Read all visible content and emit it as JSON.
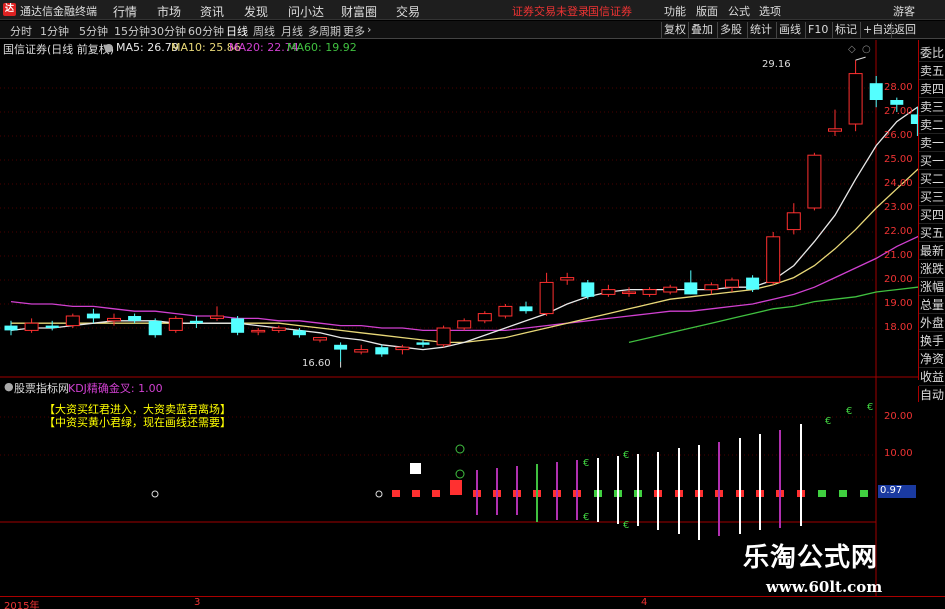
{
  "menubar": {
    "app_title": "通达信金融终端",
    "menus": [
      "行情",
      "市场",
      "资讯",
      "发现",
      "问小达",
      "财富圈",
      "交易"
    ],
    "alerts": [
      "证券交易未登录",
      "国信证券"
    ],
    "right_menus": [
      "功能",
      "版面",
      "公式",
      "选项"
    ],
    "user": "游客"
  },
  "toolbar": {
    "periods": [
      "分时",
      "1分钟",
      "5分钟",
      "15分钟",
      "30分钟",
      "60分钟",
      "日线",
      "周线",
      "月线",
      "多周期",
      "更多"
    ],
    "active_period": "日线",
    "right_buttons": [
      "复权",
      "叠加",
      "多股",
      "统计",
      "画线",
      "F10",
      "标记",
      "+自选",
      "返回"
    ]
  },
  "stock": {
    "name": "国信证券(日线 前复权)",
    "ma": [
      {
        "label": "MA5: 26.79",
        "color": "#e8e8e8"
      },
      {
        "label": "MA10: 25.86",
        "color": "#e8d878"
      },
      {
        "label": "MA20: 22.74",
        "color": "#d040d0"
      },
      {
        "label": "MA60: 19.92",
        "color": "#40c040"
      }
    ],
    "high_label": "29.16",
    "low_label": "16.60"
  },
  "side_tabs": [
    "委比",
    "卖五",
    "卖四",
    "卖三",
    "卖二",
    "卖一",
    "买一",
    "买二",
    "买三",
    "买四",
    "买五",
    "最新",
    "涨跌",
    "涨幅",
    "总量",
    "外盘",
    "换手",
    "净资",
    "收益"
  ],
  "side_auto": "自动",
  "price_axis": [
    "28.00",
    "27.00",
    "26.00",
    "25.00",
    "24.00",
    "23.00",
    "22.00",
    "21.00",
    "20.00",
    "19.00",
    "18.00"
  ],
  "indicator": {
    "title": "股票指标网",
    "subtitle": "KDJ精确金叉: 1.00",
    "strategy_lines": [
      "【大资买红君进入，大资卖蓝君离场】",
      "【中资买黄小君绿，现在画线还需要】"
    ],
    "axis": [
      "20.00",
      "10.00"
    ],
    "current_value": "0.97"
  },
  "date_axis": [
    "2015年",
    "3",
    "4"
  ],
  "watermark": {
    "cn": "乐淘公式网",
    "url": "www.60lt.com"
  },
  "colors": {
    "up": "#ff3030",
    "down": "#54ffff",
    "axis": "#a00000",
    "grid": "#4a0000"
  },
  "chart_data": {
    "type": "candlestick",
    "candles": [
      {
        "o": 18.1,
        "c": 17.9,
        "h": 18.3,
        "l": 17.7
      },
      {
        "o": 17.9,
        "c": 18.2,
        "h": 18.4,
        "l": 17.8
      },
      {
        "o": 18.1,
        "c": 18.0,
        "h": 18.3,
        "l": 17.9
      },
      {
        "o": 18.1,
        "c": 18.5,
        "h": 18.6,
        "l": 18.0
      },
      {
        "o": 18.6,
        "c": 18.4,
        "h": 18.8,
        "l": 18.2
      },
      {
        "o": 18.3,
        "c": 18.4,
        "h": 18.6,
        "l": 18.1
      },
      {
        "o": 18.5,
        "c": 18.3,
        "h": 18.6,
        "l": 18.2
      },
      {
        "o": 18.3,
        "c": 17.7,
        "h": 18.4,
        "l": 17.6
      },
      {
        "o": 17.9,
        "c": 18.4,
        "h": 18.5,
        "l": 17.8
      },
      {
        "o": 18.3,
        "c": 18.2,
        "h": 18.5,
        "l": 18.0
      },
      {
        "o": 18.4,
        "c": 18.5,
        "h": 18.9,
        "l": 18.3
      },
      {
        "o": 18.4,
        "c": 17.8,
        "h": 18.5,
        "l": 17.7
      },
      {
        "o": 17.9,
        "c": 17.9,
        "h": 18.0,
        "l": 17.7
      },
      {
        "o": 17.9,
        "c": 18.0,
        "h": 18.1,
        "l": 17.8
      },
      {
        "o": 17.9,
        "c": 17.7,
        "h": 18.0,
        "l": 17.6
      },
      {
        "o": 17.5,
        "c": 17.6,
        "h": 17.6,
        "l": 17.4
      },
      {
        "o": 17.3,
        "c": 17.1,
        "h": 17.4,
        "l": 16.6
      },
      {
        "o": 17.0,
        "c": 17.1,
        "h": 17.3,
        "l": 16.9
      },
      {
        "o": 17.2,
        "c": 16.9,
        "h": 17.3,
        "l": 16.8
      },
      {
        "o": 17.1,
        "c": 17.2,
        "h": 17.3,
        "l": 16.9
      },
      {
        "o": 17.4,
        "c": 17.3,
        "h": 17.5,
        "l": 17.2
      },
      {
        "o": 17.3,
        "c": 18.0,
        "h": 18.1,
        "l": 17.2
      },
      {
        "o": 18.0,
        "c": 18.3,
        "h": 18.4,
        "l": 17.9
      },
      {
        "o": 18.3,
        "c": 18.6,
        "h": 18.7,
        "l": 18.2
      },
      {
        "o": 18.5,
        "c": 18.9,
        "h": 19.0,
        "l": 18.4
      },
      {
        "o": 18.9,
        "c": 18.7,
        "h": 19.1,
        "l": 18.6
      },
      {
        "o": 18.6,
        "c": 19.9,
        "h": 20.3,
        "l": 18.5
      },
      {
        "o": 20.0,
        "c": 20.1,
        "h": 20.3,
        "l": 19.8
      },
      {
        "o": 19.9,
        "c": 19.3,
        "h": 20.0,
        "l": 19.2
      },
      {
        "o": 19.4,
        "c": 19.6,
        "h": 19.8,
        "l": 19.3
      },
      {
        "o": 19.5,
        "c": 19.5,
        "h": 19.7,
        "l": 19.3
      },
      {
        "o": 19.4,
        "c": 19.6,
        "h": 19.7,
        "l": 19.3
      },
      {
        "o": 19.5,
        "c": 19.7,
        "h": 19.8,
        "l": 19.4
      },
      {
        "o": 19.9,
        "c": 19.4,
        "h": 20.4,
        "l": 19.4
      },
      {
        "o": 19.6,
        "c": 19.8,
        "h": 19.9,
        "l": 19.4
      },
      {
        "o": 19.7,
        "c": 20.0,
        "h": 20.1,
        "l": 19.5
      },
      {
        "o": 20.1,
        "c": 19.6,
        "h": 20.2,
        "l": 19.5
      },
      {
        "o": 19.9,
        "c": 21.8,
        "h": 22.0,
        "l": 19.8
      },
      {
        "o": 22.1,
        "c": 22.8,
        "h": 23.2,
        "l": 21.9
      },
      {
        "o": 23.0,
        "c": 25.2,
        "h": 25.3,
        "l": 22.9
      },
      {
        "o": 26.2,
        "c": 26.3,
        "h": 27.1,
        "l": 26.0
      },
      {
        "o": 26.5,
        "c": 28.6,
        "h": 29.16,
        "l": 26.2
      },
      {
        "o": 28.2,
        "c": 27.5,
        "h": 28.5,
        "l": 27.2
      },
      {
        "o": 27.5,
        "c": 27.3,
        "h": 27.6,
        "l": 27.0
      },
      {
        "o": 26.9,
        "c": 26.5,
        "h": 27.2,
        "l": 26.0
      },
      {
        "o": 25.9,
        "c": 26.7,
        "h": 27.0,
        "l": 25.6
      },
      {
        "o": 26.8,
        "c": 26.8,
        "h": 28.3,
        "l": 26.6
      }
    ],
    "ma5": [
      17.9,
      18.0,
      18.0,
      18.1,
      18.2,
      18.3,
      18.3,
      18.3,
      18.2,
      18.2,
      18.2,
      18.2,
      18.1,
      18.0,
      17.9,
      17.8,
      17.6,
      17.5,
      17.3,
      17.2,
      17.1,
      17.2,
      17.4,
      17.7,
      18.0,
      18.3,
      18.6,
      19.0,
      19.3,
      19.5,
      19.6,
      19.6,
      19.6,
      19.6,
      19.6,
      19.7,
      19.7,
      20.0,
      20.6,
      21.6,
      22.7,
      24.2,
      25.6,
      26.6,
      27.2,
      27.3,
      26.8
    ],
    "ma10": [
      18.2,
      18.2,
      18.2,
      18.2,
      18.2,
      18.2,
      18.2,
      18.2,
      18.2,
      18.2,
      18.2,
      18.2,
      18.2,
      18.2,
      18.1,
      18.0,
      17.9,
      17.8,
      17.7,
      17.6,
      17.5,
      17.4,
      17.4,
      17.5,
      17.6,
      17.8,
      18.0,
      18.2,
      18.4,
      18.6,
      18.8,
      19.0,
      19.2,
      19.3,
      19.4,
      19.5,
      19.6,
      19.8,
      20.1,
      20.6,
      21.3,
      22.1,
      23.0,
      23.8,
      24.6,
      25.2,
      25.9
    ],
    "ma20": [
      19.1,
      19.0,
      19.0,
      18.9,
      18.9,
      18.8,
      18.7,
      18.7,
      18.6,
      18.5,
      18.5,
      18.4,
      18.4,
      18.3,
      18.3,
      18.2,
      18.1,
      18.1,
      18.0,
      18.0,
      17.9,
      17.9,
      17.9,
      17.9,
      17.9,
      18.0,
      18.1,
      18.2,
      18.3,
      18.4,
      18.5,
      18.6,
      18.7,
      18.7,
      18.8,
      18.9,
      19.0,
      19.2,
      19.4,
      19.7,
      20.1,
      20.5,
      20.9,
      21.4,
      21.8,
      22.3,
      22.7
    ],
    "ma60_start_index": 30,
    "ma60": [
      17.4,
      17.6,
      17.8,
      18.0,
      18.2,
      18.4,
      18.6,
      18.8,
      18.9,
      19.1,
      19.2,
      19.3,
      19.5,
      19.6,
      19.7,
      19.8,
      19.9
    ],
    "ylim": [
      16.0,
      29.5
    ]
  }
}
